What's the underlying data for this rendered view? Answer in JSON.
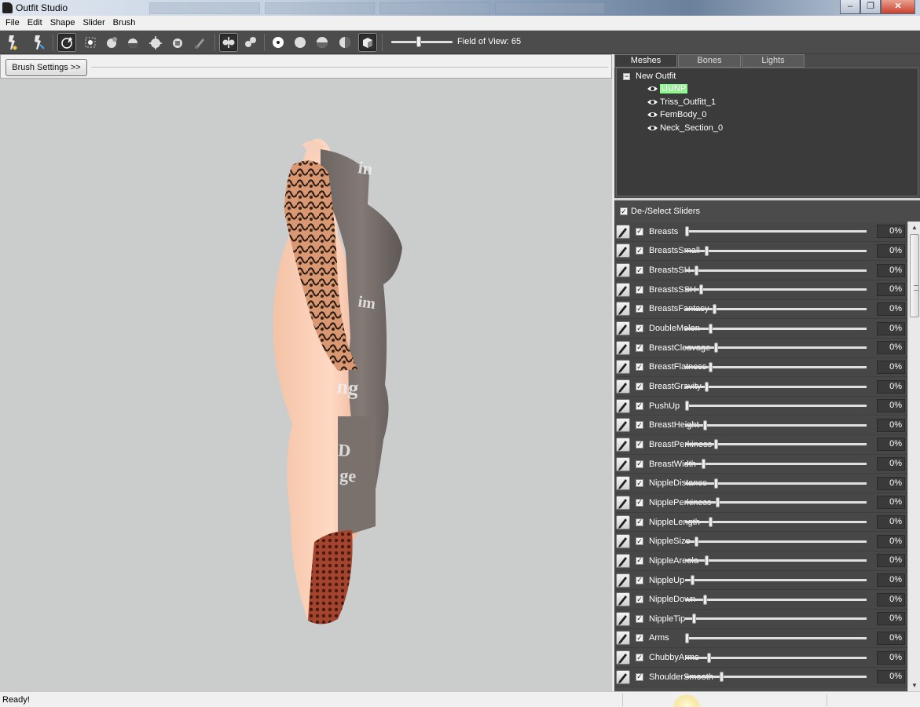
{
  "window": {
    "title": "Outfit Studio"
  },
  "menu": [
    "File",
    "Edit",
    "Shape",
    "Slider",
    "Brush"
  ],
  "toolbar": {
    "field_of_view_label": "Field of View: 65",
    "field_of_view_value": 65,
    "tools": [
      "select-tool-icon",
      "transform-tool-icon",
      "mask-brush-icon",
      "inflate-brush-icon",
      "deflate-brush-icon",
      "move-brush-icon",
      "smooth-brush-icon",
      "weight-brush-icon",
      "color-brush-icon",
      "mirror-x-icon",
      "connected-mesh-icon",
      "vertex-view-icon",
      "wireframe-view-icon",
      "lighting-view-icon",
      "texture-view-icon",
      "shaded-view-icon"
    ]
  },
  "brush_settings": {
    "label": "Brush Settings >>"
  },
  "mesh_panel": {
    "tabs": [
      "Meshes",
      "Bones",
      "Lights"
    ],
    "active_tab": "Meshes",
    "root": "New Outfit",
    "root_toggle": "−",
    "meshes": [
      {
        "name": "UUNP",
        "selected": true
      },
      {
        "name": "Triss_Outfitt_1",
        "selected": false
      },
      {
        "name": "FemBody_0",
        "selected": false
      },
      {
        "name": "Neck_Section_0",
        "selected": false
      }
    ]
  },
  "slider_panel": {
    "header": "De-/Select Sliders",
    "check_mark": "✓",
    "sliders": [
      {
        "name": "Breasts",
        "value": "0%",
        "thumb": 0.0
      },
      {
        "name": "BreastsSmall",
        "value": "0%",
        "thumb": 0.11
      },
      {
        "name": "BreastsSH",
        "value": "0%",
        "thumb": 0.05
      },
      {
        "name": "BreastsSSH",
        "value": "0%",
        "thumb": 0.08
      },
      {
        "name": "BreastsFantasy",
        "value": "0%",
        "thumb": 0.15
      },
      {
        "name": "DoubleMelon",
        "value": "0%",
        "thumb": 0.13
      },
      {
        "name": "BreastCleavage",
        "value": "0%",
        "thumb": 0.16
      },
      {
        "name": "BreastFlatness",
        "value": "0%",
        "thumb": 0.13
      },
      {
        "name": "BreastGravity",
        "value": "0%",
        "thumb": 0.11
      },
      {
        "name": "PushUp",
        "value": "0%",
        "thumb": 0.0
      },
      {
        "name": "BreastHeight",
        "value": "0%",
        "thumb": 0.1
      },
      {
        "name": "BreastPerkiness",
        "value": "0%",
        "thumb": 0.16
      },
      {
        "name": "BreastWidth",
        "value": "0%",
        "thumb": 0.09
      },
      {
        "name": "NippleDistance",
        "value": "0%",
        "thumb": 0.16
      },
      {
        "name": "NipplePerkiness",
        "value": "0%",
        "thumb": 0.17
      },
      {
        "name": "NippleLength",
        "value": "0%",
        "thumb": 0.13
      },
      {
        "name": "NippleSize",
        "value": "0%",
        "thumb": 0.05
      },
      {
        "name": "NippleAreola",
        "value": "0%",
        "thumb": 0.11
      },
      {
        "name": "NippleUp",
        "value": "0%",
        "thumb": 0.03
      },
      {
        "name": "NippleDown",
        "value": "0%",
        "thumb": 0.1
      },
      {
        "name": "NippleTip",
        "value": "0%",
        "thumb": 0.04
      },
      {
        "name": "Arms",
        "value": "0%",
        "thumb": 0.0
      },
      {
        "name": "ChubbyArms",
        "value": "0%",
        "thumb": 0.12
      },
      {
        "name": "ShoulderSmooth",
        "value": "0%",
        "thumb": 0.19
      }
    ]
  },
  "status": {
    "text": "Ready!"
  },
  "colors": {
    "panel": "#4b4b4b",
    "viewport": "#cbcdcd",
    "selected_mesh": "#8cff8c",
    "toolbar": "#4c4c4c"
  }
}
